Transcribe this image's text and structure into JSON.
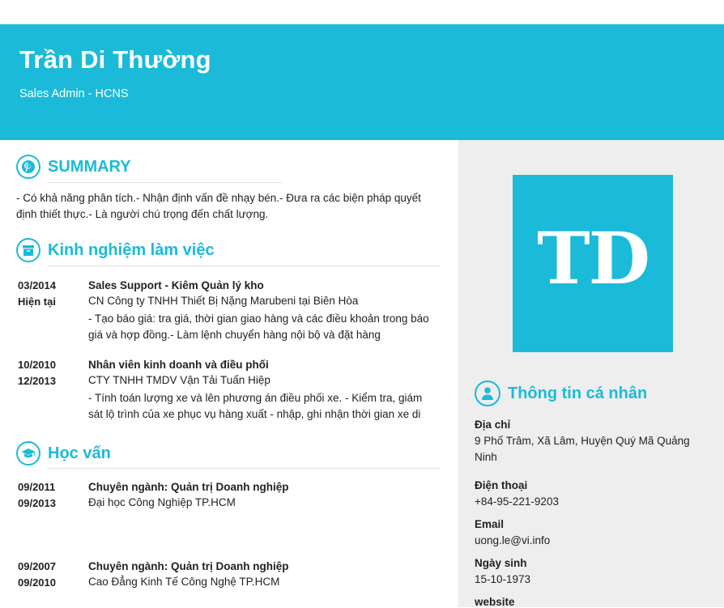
{
  "header": {
    "name": "Trần Di Thường",
    "role": "Sales Admin - HCNS"
  },
  "summary": {
    "title": "SUMMARY",
    "text": "- Có khả năng phân tích.- Nhận định vấn đề nhạy bén.- Đưa ra các biện pháp quyết định thiết thực.- Là người chú trọng đến chất lượng."
  },
  "experience": {
    "title": "Kinh nghiệm làm việc",
    "items": [
      {
        "date_from": "03/2014",
        "date_to": "Hiện tại",
        "position": "Sales Support - Kiêm Quản lý kho",
        "company": "CN Công ty TNHH Thiết Bị Nặng Marubeni tại Biên Hòa",
        "description": "- Tạo báo giá: tra giá, thời gian giao hàng và các điều khoản trong báo giá và hợp đồng.- Làm lệnh chuyển hàng nội bộ và đặt hàng"
      },
      {
        "date_from": "10/2010",
        "date_to": "12/2013",
        "position": "Nhân viên kinh doanh và điều phối",
        "company": "CTY TNHH TMDV Vận Tải Tuấn Hiệp",
        "description": "- Tính toán lượng xe và lên phương án điều phối xe. - Kiểm tra, giám sát lộ trình của xe phục vụ hàng xuất - nhập, ghi nhận thời gian xe di"
      }
    ]
  },
  "education": {
    "title": "Học vấn",
    "items": [
      {
        "date_from": "09/2011",
        "date_to": "09/2013",
        "major": "Chuyên ngành: Quản trị Doanh nghiệp",
        "school": "Đại học Công Nghiệp TP.HCM"
      },
      {
        "date_from": "09/2007",
        "date_to": "09/2010",
        "major": "Chuyên ngành: Quản trị Doanh nghiệp",
        "school": "Cao Đẳng Kinh Tế Công Nghệ TP.HCM"
      }
    ]
  },
  "sidebar": {
    "monogram": "TD",
    "personal_title": "Thông tin cá nhân",
    "address_label": "Địa chỉ",
    "address_value": "9 Phố Trâm, Xã Lâm, Huyện Quý Mã Quảng Ninh",
    "phone_label": "Điện thoại",
    "phone_value": "+84-95-221-9203",
    "email_label": "Email",
    "email_value": "uong.le@vi.info",
    "birthday_label": "Ngày sinh",
    "birthday_value": "15-10-1973",
    "website_label": "website"
  },
  "colors": {
    "accent": "#1bbad9",
    "sidebar_bg": "#eeeeee",
    "text": "#222222"
  },
  "icons": {
    "summary": "pinterest-icon",
    "experience": "archive-box-icon",
    "education": "graduation-cap-icon",
    "personal": "user-icon"
  }
}
